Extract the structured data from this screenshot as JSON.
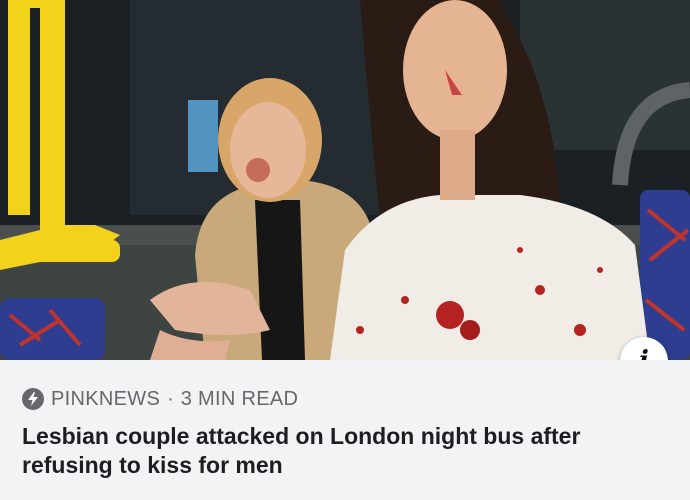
{
  "post": {
    "source": "PINKNEWS",
    "separator": "·",
    "read_time": "3 MIN READ",
    "headline": "Lesbian couple attacked on London night bus after refusing to kiss for men",
    "info_glyph": "i"
  },
  "icons": {
    "source_icon": "lightning-bolt-icon",
    "info_icon": "info-icon"
  },
  "colors": {
    "caption_background": "#f2f3f5",
    "meta_text": "#65676b",
    "headline_text": "#1c1e21",
    "bus_rail_yellow": "#f2d21b",
    "seat_blue": "#2e3d8f"
  }
}
